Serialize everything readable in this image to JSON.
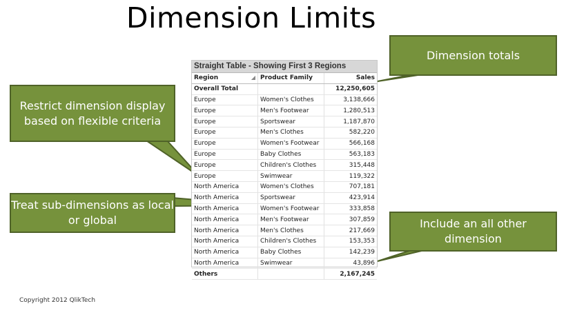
{
  "slide_title": "Dimension Limits",
  "table": {
    "caption": "Straight Table - Showing First 3 Regions",
    "headers": [
      "Region",
      "Product Family",
      "Sales"
    ],
    "total_row": [
      "Overall Total",
      "",
      "12,250,605"
    ],
    "rows": [
      [
        "Europe",
        "Women's Clothes",
        "3,138,666"
      ],
      [
        "Europe",
        "Men's Footwear",
        "1,280,513"
      ],
      [
        "Europe",
        "Sportswear",
        "1,187,870"
      ],
      [
        "Europe",
        "Men's Clothes",
        "582,220"
      ],
      [
        "Europe",
        "Women's Footwear",
        "566,168"
      ],
      [
        "Europe",
        "Baby Clothes",
        "563,183"
      ],
      [
        "Europe",
        "Children's Clothes",
        "315,448"
      ],
      [
        "Europe",
        "Swimwear",
        "119,322"
      ],
      [
        "North America",
        "Women's Clothes",
        "707,181"
      ],
      [
        "North America",
        "Sportswear",
        "423,914"
      ],
      [
        "North America",
        "Women's Footwear",
        "333,858"
      ],
      [
        "North America",
        "Men's Footwear",
        "307,859"
      ],
      [
        "North America",
        "Men's Clothes",
        "217,669"
      ],
      [
        "North America",
        "Children's Clothes",
        "153,353"
      ],
      [
        "North America",
        "Baby Clothes",
        "142,239"
      ],
      [
        "North America",
        "Swimwear",
        "43,896"
      ]
    ],
    "others_row": [
      "Others",
      "",
      "2,167,245"
    ]
  },
  "callouts": {
    "totals": "Dimension totals",
    "restrict": "Restrict dimension display based on flexible criteria",
    "treat": "Treat sub-dimensions as local or global",
    "others": "Include an all other dimension"
  },
  "colors": {
    "callout_fill": "#76923c",
    "callout_border": "#4f6228"
  },
  "copyright": "Copyright 2012 QlikTech"
}
